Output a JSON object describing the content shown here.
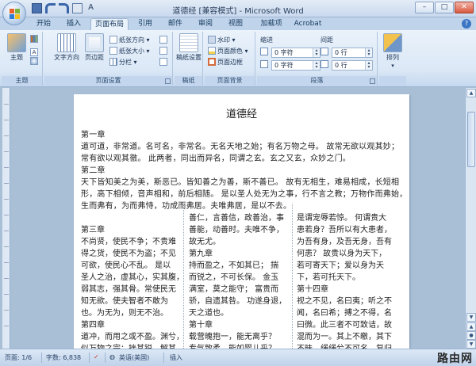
{
  "window": {
    "title": "道德经 [兼容模式] - Microsoft Word",
    "controls": {
      "minimize": "–",
      "maximize": "□",
      "close": "✕"
    }
  },
  "tabs": [
    "开始",
    "插入",
    "页面布局",
    "引用",
    "邮件",
    "审阅",
    "视图",
    "加载项",
    "Acrobat"
  ],
  "active_tab": "页面布局",
  "ribbon": {
    "theme": {
      "label": "主题",
      "button": "主题"
    },
    "page_setup": {
      "label": "页面设置",
      "text_direction": "文字方向",
      "margins": "页边距",
      "orientation": "纸张方向",
      "size": "纸张大小",
      "columns": "分栏"
    },
    "draft": {
      "label": "稿纸",
      "button": "稿纸设置"
    },
    "page_background": {
      "label": "页面背景",
      "watermark": "水印",
      "page_color": "页面颜色",
      "page_border": "页面边框"
    },
    "paragraph": {
      "label": "段落",
      "indent_label": "缩进",
      "spacing_label": "间距",
      "indent_left": "0 字符",
      "indent_right": "0 字符",
      "space_before": "0 行",
      "space_after": "0 行"
    },
    "arrange": {
      "label": "",
      "button": "排列"
    }
  },
  "document": {
    "title": "道德经",
    "full_lines": [
      "第一章",
      "道可道，非常道。名可名，非常名。无名天地之始；有名万物之母。 故常无欲以观其妙；",
      "常有欲以观其徼。 此两者，同出而异名，同谓之玄。玄之又玄，众妙之门。",
      "第二章",
      "天下皆知美之为美，斯恶已。皆知善之为善，斯不善已。 故有无相生，难易相成，长短相",
      "形，高下相倾，音声相和，前后相随。 是以圣人处无为之事，行不言之教；万物作而弗始，",
      "生而弗有，为而弗恃，功成而弗居。夫唯弗居，是以不去。"
    ],
    "col1": [
      "第三章",
      "不尚贤，使民不争；不贵难",
      "得之货，使民不为盗；不见",
      "可欲，使民心不乱。 是以",
      "圣人之治，虚其心，实其腹，",
      "弱其志，强其骨。常使民无",
      "知无欲。使夫智者不敢为",
      "也。为无为，则无不治。",
      "第四章",
      "道冲，而用之或不盈。渊兮，",
      "似万物之宗；挫其锐，解其"
    ],
    "col2": [
      "善仁，言善信，政善治，事",
      "善能，动善时。夫唯不争，",
      "故无尤。",
      "第九章",
      "持而盈之，不如其已； 揣",
      "而锐之，不可长保。 金玉",
      "满室，莫之能守； 富贵而",
      "骄，自遗其咎。 功遂身退，",
      "天之道也。",
      "第十章",
      "载营魄抱一，能无离乎？",
      "专气致柔，能如婴儿乎？"
    ],
    "col3": [
      "是谓宠辱若惊。 何谓贵大",
      "患若身？吾所以有大患者，",
      "为吾有身，及吾无身，吾有",
      "何患？ 故贵以身为天下，",
      "若可寄天下；爱以身为天",
      "下，若可托天下。",
      "第十四章",
      "视之不见，名曰夷；听之不",
      "闻，名曰希；搏之不得，名",
      "曰微。此三者不可致诘，故",
      "混而为一。其上不皦，其下",
      "不昧。绳绳兮不可名，复归"
    ]
  },
  "status": {
    "page": "页面: 1/6",
    "words": "字数: 6,838",
    "language": "英语(美国)",
    "mode": "插入"
  },
  "watermark_text": "路由网"
}
